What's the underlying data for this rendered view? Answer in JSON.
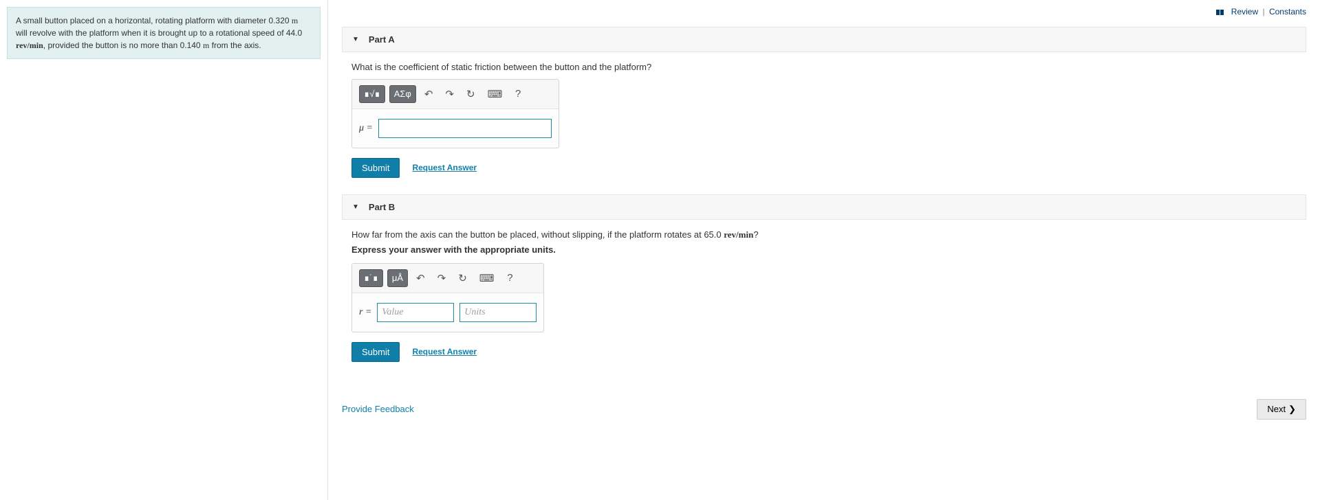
{
  "top": {
    "review": "Review",
    "constants": "Constants"
  },
  "problem": {
    "text_pre": "A small button placed on a horizontal, rotating platform with diameter 0.320 ",
    "unit_m1": "m",
    "text_mid1": " will revolve with the platform when it is brought up to a rotational speed of 44.0 ",
    "unit_revmin1": "rev/min",
    "text_mid2": ", provided the button is no more than 0.140 ",
    "unit_m2": "m",
    "text_mid3": " from the axis."
  },
  "partA": {
    "title": "Part A",
    "question": "What is the coefficient of static friction between the button and the platform?",
    "var_label": "μ =",
    "toolbar": {
      "templates_label": "∎√∎",
      "greek_label": "ΑΣφ",
      "undo": "↶",
      "redo": "↷",
      "reset": "↻",
      "keyboard": "⌨",
      "help": "?"
    },
    "submit": "Submit",
    "request": "Request Answer"
  },
  "partB": {
    "title": "Part B",
    "question_pre": "How far from the axis can the button be placed, without slipping, if the platform rotates at 65.0 ",
    "unit_revmin": "rev/min",
    "question_post": "?",
    "instruction": "Express your answer with the appropriate units.",
    "var_label": "r =",
    "value_placeholder": "Value",
    "units_placeholder": "Units",
    "toolbar": {
      "templates_label": "∎˙∎",
      "units_label": "μÅ",
      "undo": "↶",
      "redo": "↷",
      "reset": "↻",
      "keyboard": "⌨",
      "help": "?"
    },
    "submit": "Submit",
    "request": "Request Answer"
  },
  "footer": {
    "feedback": "Provide Feedback",
    "next": "Next"
  }
}
